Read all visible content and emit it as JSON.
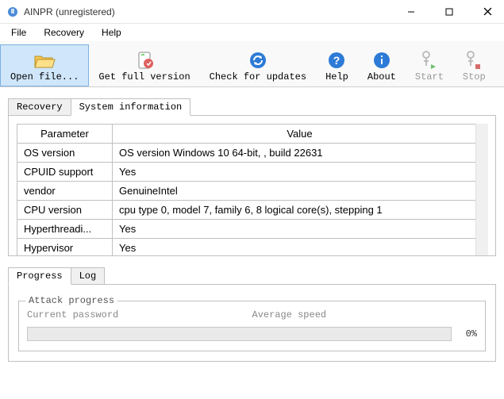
{
  "window": {
    "title": "AINPR (unregistered)"
  },
  "menubar": [
    "File",
    "Recovery",
    "Help"
  ],
  "toolbar": [
    {
      "key": "open",
      "label": "Open file...",
      "iconColor": "#f7c74f",
      "enabled": true,
      "selected": true
    },
    {
      "key": "getfull",
      "label": "Get full version",
      "iconColor": "#e06060",
      "enabled": true,
      "selected": false
    },
    {
      "key": "updates",
      "label": "Check for updates",
      "iconColor": "#2d7bd6",
      "enabled": true,
      "selected": false
    },
    {
      "key": "help",
      "label": "Help",
      "iconColor": "#2d7bd6",
      "enabled": true,
      "selected": false
    },
    {
      "key": "about",
      "label": "About",
      "iconColor": "#2d7bd6",
      "enabled": true,
      "selected": false
    },
    {
      "key": "start",
      "label": "Start",
      "iconColor": "#bdbdbd",
      "enabled": false,
      "selected": false
    },
    {
      "key": "stop",
      "label": "Stop",
      "iconColor": "#bdbdbd",
      "enabled": false,
      "selected": false
    }
  ],
  "topTabs": {
    "items": [
      "Recovery",
      "System information"
    ],
    "active": 1
  },
  "sysinfo": {
    "headers": [
      "Parameter",
      "Value"
    ],
    "rows": [
      {
        "param": "OS version",
        "value": "OS version Windows 10 64-bit, , build 22631"
      },
      {
        "param": "CPUID support",
        "value": "Yes"
      },
      {
        "param": "vendor",
        "value": "GenuineIntel"
      },
      {
        "param": "CPU version",
        "value": "cpu type 0, model 7, family 6, 8 logical core(s), stepping 1"
      },
      {
        "param": "Hyperthreadi...",
        "value": "Yes"
      },
      {
        "param": "Hypervisor",
        "value": "Yes"
      }
    ]
  },
  "bottomTabs": {
    "items": [
      "Progress",
      "Log"
    ],
    "active": 0
  },
  "progress": {
    "legend": "Attack progress",
    "leftLabel": "Current password",
    "rightLabel": "Average speed",
    "percentText": "0%"
  }
}
